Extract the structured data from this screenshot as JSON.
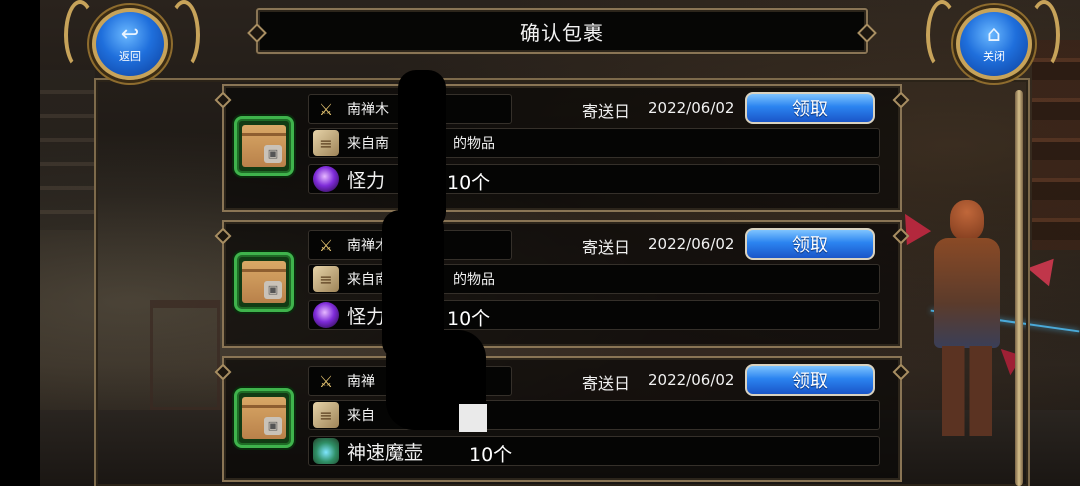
{
  "header": {
    "title": "确认包裹",
    "back_label": "返回",
    "close_label": "关闭"
  },
  "rows": [
    {
      "sender": "南禅木",
      "subject_prefix": "来自南",
      "subject_suffix": "的物品",
      "send_label": "寄送日",
      "send_date": "2022/06/02",
      "claim_label": "领取",
      "item_name": "怪力",
      "item_qty": "10个",
      "item_icon": "purple-orb-icon"
    },
    {
      "sender": "南禅木",
      "subject_prefix": "来自南",
      "subject_suffix": "的物品",
      "send_label": "寄送日",
      "send_date": "2022/06/02",
      "claim_label": "领取",
      "item_name": "怪力",
      "item_qty": "10个",
      "item_icon": "purple-orb-icon"
    },
    {
      "sender": "南禅",
      "subject_prefix": "来自",
      "subject_suffix": "",
      "send_label": "寄送日",
      "send_date": "2022/06/02",
      "claim_label": "领取",
      "item_name": "神速魔壶",
      "item_qty": "10个",
      "item_icon": "green-potion-icon"
    }
  ],
  "colors": {
    "frame_gold": "#8a7555",
    "claim_button_blue": "#2b84f0",
    "parcel_border_green": "#3fb34c"
  }
}
